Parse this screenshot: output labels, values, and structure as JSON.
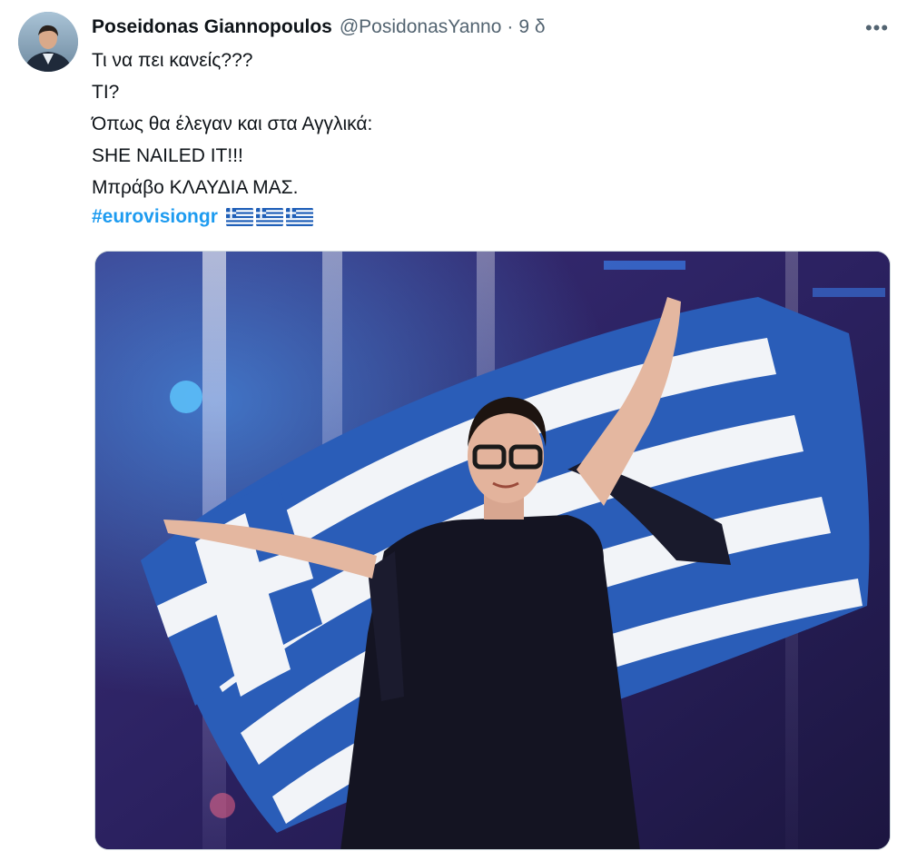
{
  "tweet": {
    "author_name": "Poseidonas Giannopoulos",
    "author_handle": "@PosidonasYanno",
    "separator": "·",
    "time": "9 δ",
    "more_label": "•••",
    "lines": [
      "Τι να πει κανείς???",
      "ΤΙ?",
      "Όπως θα έλεγαν και στα Αγγλικά:",
      "SHE NAILED IT!!!",
      "Μπράβο ΚΛΑΥΔΙΑ ΜΑΣ."
    ],
    "hashtag": "#eurovisiongr",
    "flags": [
      "greece-flag",
      "greece-flag",
      "greece-flag"
    ]
  },
  "colors": {
    "hashtag": "#1d9bf0",
    "secondary_text": "#536471",
    "flag_blue": "#1f5fb8",
    "flag_white": "#ffffff"
  },
  "media": {
    "description_icon": "photo-performer-with-greek-flag"
  }
}
